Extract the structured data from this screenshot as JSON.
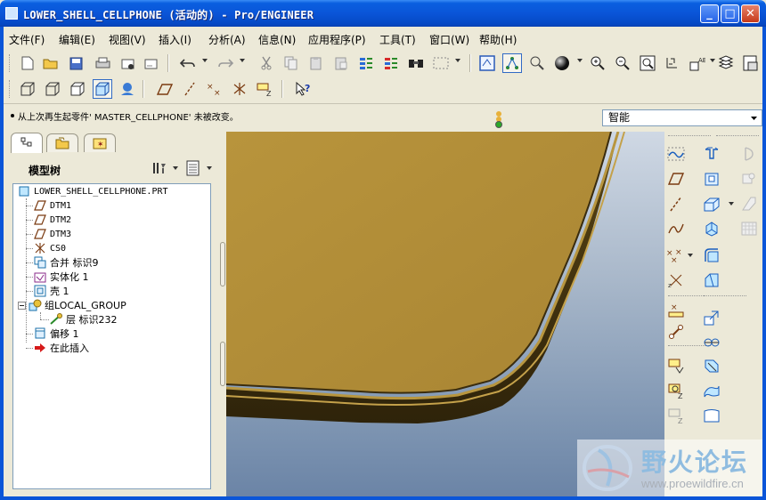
{
  "window": {
    "title": "LOWER_SHELL_CELLPHONE (活动的) - Pro/ENGINEER",
    "minimize": "_",
    "maximize": "□",
    "close": "✕"
  },
  "menubar": {
    "items": [
      {
        "label": "文件(F)"
      },
      {
        "label": "编辑(E)"
      },
      {
        "label": "视图(V)"
      },
      {
        "label": "插入(I)"
      },
      {
        "label": "分析(A)"
      },
      {
        "label": "信息(N)"
      },
      {
        "label": "应用程序(P)"
      },
      {
        "label": "工具(T)"
      },
      {
        "label": "窗口(W)"
      },
      {
        "label": "帮助(H)"
      }
    ]
  },
  "toolbar_top": {
    "icons": [
      "new-icon",
      "open-icon",
      "save-icon",
      "print-icon",
      "email-icon",
      "email-link-icon",
      "undo-icon",
      "redo-icon",
      "cut-icon",
      "copy-icon",
      "paste-icon",
      "paste-special-icon",
      "regenerate-icon",
      "regen-manager-icon",
      "find-icon",
      "select-box-icon",
      "repaint-icon",
      "spin-center-icon",
      "saved-view-icon",
      "shading-sphere-icon",
      "zoom-in-icon",
      "zoom-out-icon",
      "refit-icon",
      "reorient-icon",
      "view-manager-icon",
      "layers-icon",
      "layer-tree-icon"
    ]
  },
  "toolbar_second": {
    "icons": [
      "wireframe-icon",
      "hidden-line-icon",
      "no-hidden-icon",
      "shading-icon",
      "enhanced-realism-icon",
      "datum-plane-display-icon",
      "datum-axis-display-icon",
      "datum-point-display-icon",
      "csys-display-icon",
      "annotation-display-icon",
      "context-help-icon"
    ]
  },
  "message": {
    "text": "从上次再生起零件' MASTER_CELLPHONE' 未被改变。"
  },
  "filter": {
    "selected": "智能"
  },
  "navigator": {
    "tabs": [
      "model-tree-tab",
      "folder-browser-tab",
      "favorites-tab"
    ],
    "panel_label": "模型树",
    "tree": [
      {
        "label": "LOWER_SHELL_CELLPHONE.PRT",
        "icon": "part-icon",
        "mono": true
      },
      {
        "label": "DTM1",
        "icon": "datum-plane-icon",
        "mono": true
      },
      {
        "label": "DTM2",
        "icon": "datum-plane-icon",
        "mono": true
      },
      {
        "label": "DTM3",
        "icon": "datum-plane-icon",
        "mono": true
      },
      {
        "label": "CS0",
        "icon": "csys-icon",
        "mono": true
      },
      {
        "label": "合并 标识9",
        "icon": "merge-icon",
        "mono": false
      },
      {
        "label": "实体化 1",
        "icon": "solidify-icon",
        "mono": false
      },
      {
        "label": "壳 1",
        "icon": "shell-icon",
        "mono": false
      },
      {
        "label": "组LOCAL_GROUP",
        "icon": "group-icon",
        "mono": false
      },
      {
        "label": "层 标识232",
        "icon": "layer-feature-icon",
        "mono": false
      },
      {
        "label": "偏移 1",
        "icon": "offset-icon",
        "mono": false
      },
      {
        "label": "在此插入",
        "icon": "insert-here-icon",
        "mono": false
      }
    ]
  },
  "right_toolbar": {
    "icons": [
      "sketched-datum-curve-icon",
      "extrude-icon",
      "revolve-icon",
      "datum-plane-tool-icon",
      "hole-icon",
      "rib-icon",
      "datum-axis-tool-icon",
      "shell-tool-icon",
      "draft-icon",
      "datum-curve-icon",
      "pattern-icon",
      "round-icon",
      "datum-point-tool-icon",
      "chamfer-icon",
      "csys-tool-icon",
      "analysis-feature-icon",
      "offset-tool-icon",
      "mirror-icon",
      "trim-icon",
      "merge-tool-icon",
      "intersect-icon",
      "extend-icon",
      "thicken-icon",
      "style-icon"
    ]
  },
  "watermark": {
    "name": "野火论坛",
    "url": "www.proewildfire.cn"
  },
  "colors": {
    "titlebar": "#0a55d8",
    "model_face": "#b6913a",
    "model_edge": "#3a2c0e",
    "viewport_bg": "#8da2bd"
  }
}
